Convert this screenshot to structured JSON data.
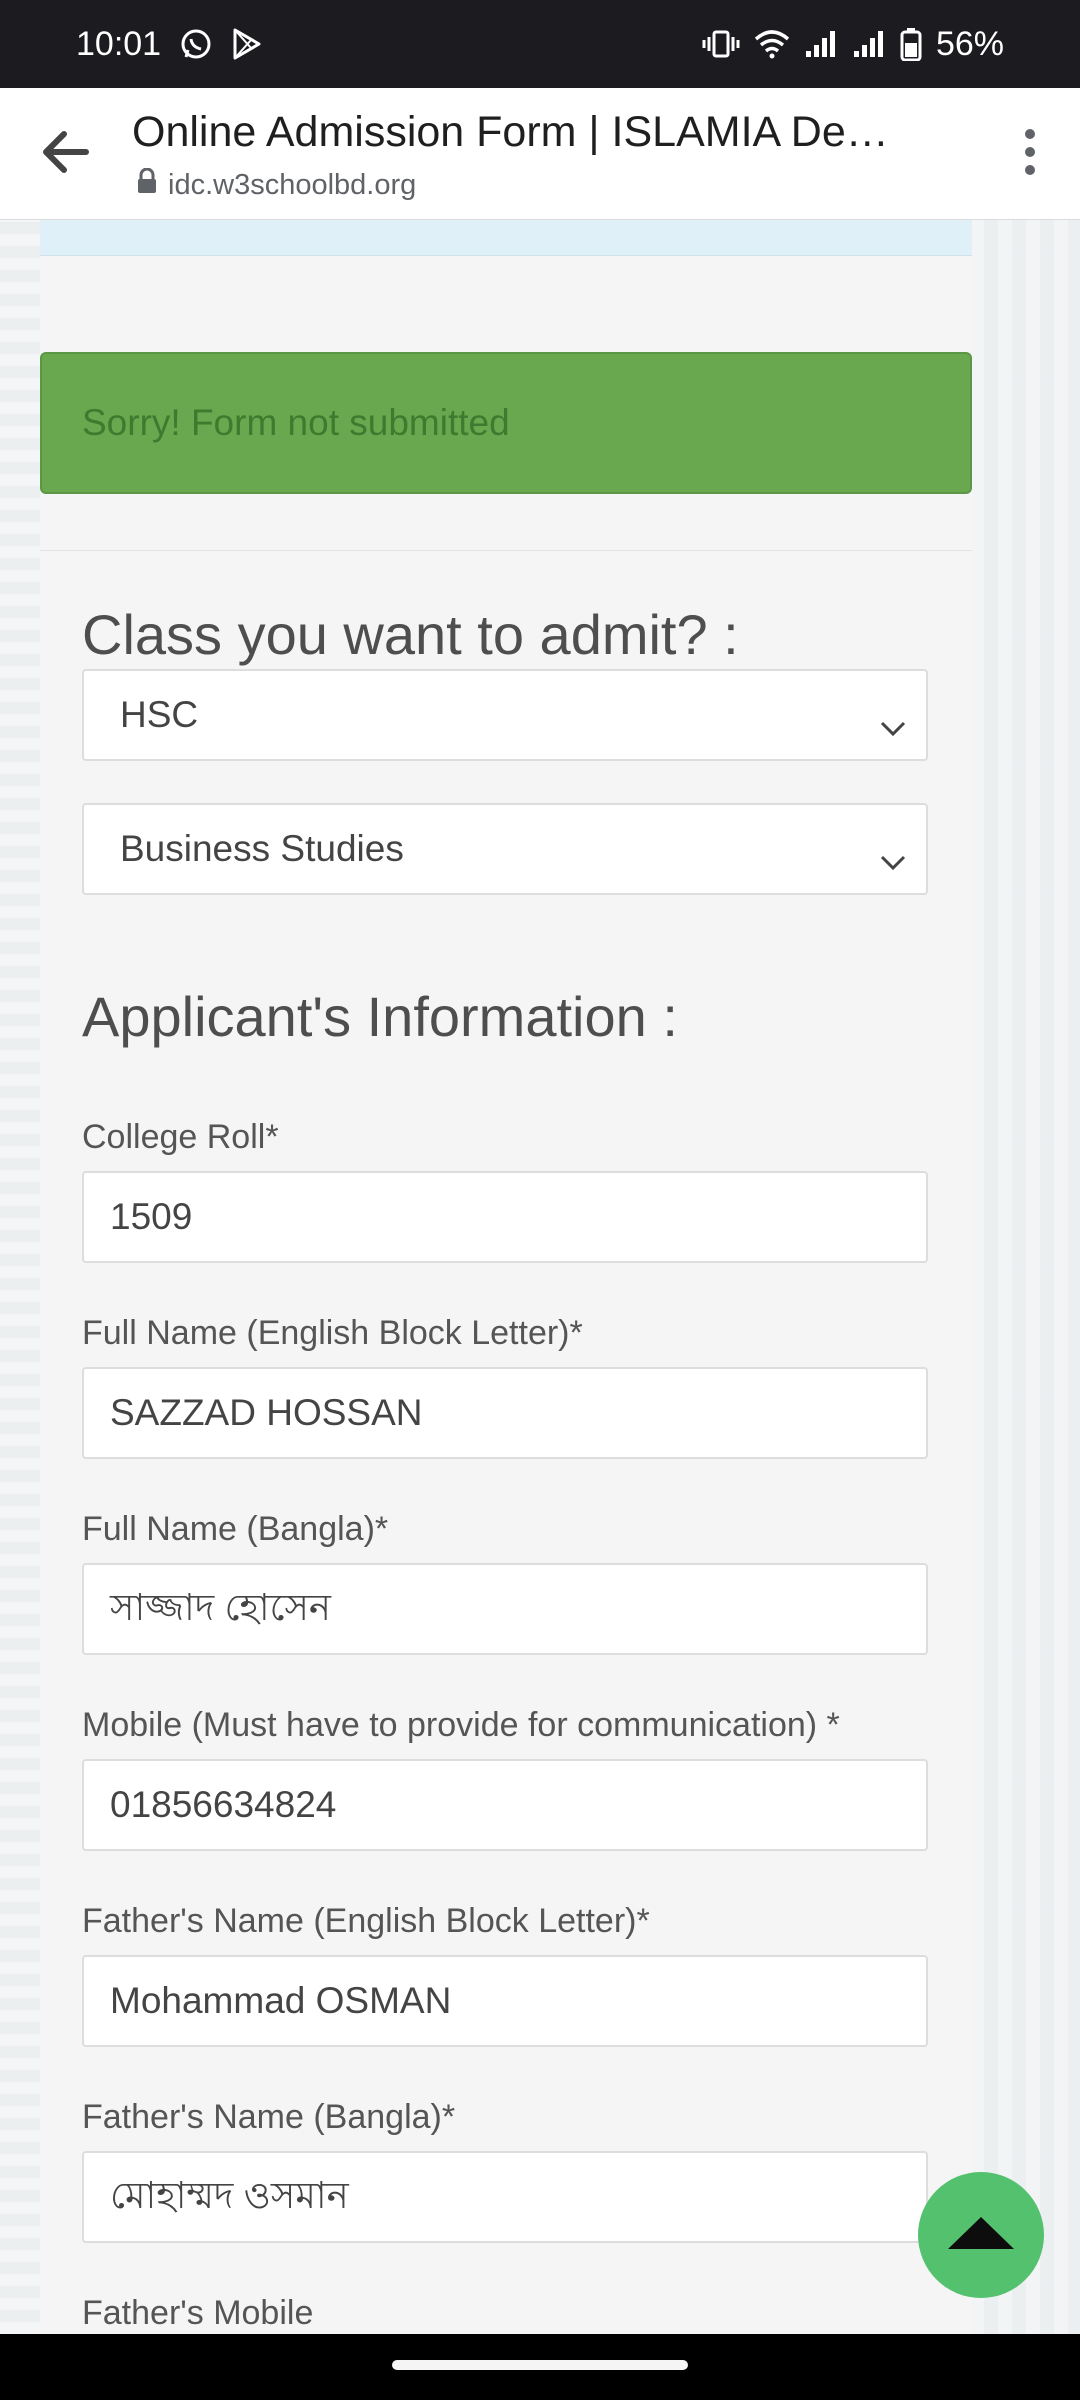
{
  "status_bar": {
    "time": "10:01",
    "battery_percent": "56%",
    "icons": [
      "whatsapp-icon",
      "play-store-icon",
      "vibrate-icon",
      "wifi-icon",
      "signal-icon",
      "signal-icon",
      "battery-icon"
    ]
  },
  "browser": {
    "title": "Online Admission Form | ISLAMIA De…",
    "url": "idc.w3schoolbd.org"
  },
  "alert": {
    "message": "Sorry! Form not submitted",
    "color": "#6aa84f"
  },
  "class_section": {
    "heading": "Class you want to admit? :",
    "class_select": "HSC",
    "group_select": "Business Studies"
  },
  "applicant": {
    "heading": "Applicant's Information :",
    "fields": [
      {
        "label": "College Roll*",
        "value": "1509"
      },
      {
        "label": "Full Name (English Block Letter)*",
        "value": "SAZZAD HOSSAN"
      },
      {
        "label": "Full Name (Bangla)*",
        "value": "সাজ্জাদ হোসেন"
      },
      {
        "label": "Mobile (Must have to provide for communication) *",
        "value": "01856634824"
      },
      {
        "label": "Father's Name (English Block Letter)*",
        "value": "Mohammad OSMAN"
      },
      {
        "label": "Father's Name (Bangla)*",
        "value": "মোহাম্মদ ওসমান"
      },
      {
        "label": "Father's Mobile",
        "value": ""
      }
    ]
  },
  "fab": {
    "icon": "arrow-up-icon",
    "color": "#53c16d"
  }
}
